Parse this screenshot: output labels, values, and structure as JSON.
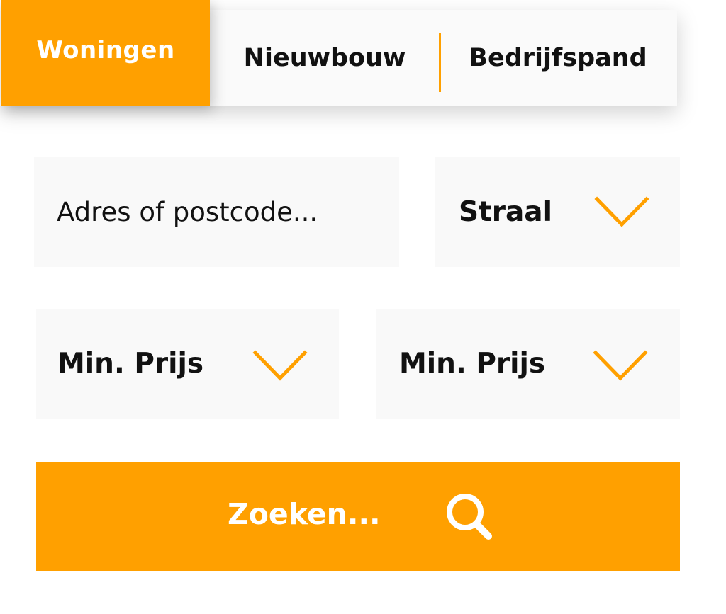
{
  "tabs": {
    "active_label": "Woningen",
    "items": [
      {
        "label": "Nieuwbouw"
      },
      {
        "label": "Bedrijfspand"
      }
    ]
  },
  "search_form": {
    "address_placeholder": "Adres of postcode...",
    "radius_label": "Straal",
    "min_price_label_1": "Min. Prijs",
    "min_price_label_2": "Min. Prijs",
    "submit_label": "Zoeken..."
  },
  "icons": {
    "dropdown": "chevron-down-icon",
    "submit": "search-icon"
  },
  "colors": {
    "accent": "#ffa000",
    "field_background": "#f9f9f9",
    "text": "#111111"
  }
}
